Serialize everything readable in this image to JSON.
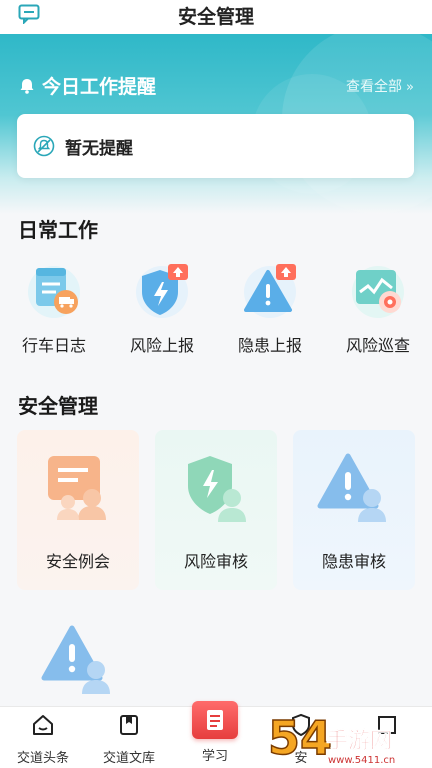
{
  "header": {
    "title": "安全管理"
  },
  "reminder": {
    "title": "今日工作提醒",
    "view_all": "查看全部",
    "view_all_chevron": "»",
    "empty_text": "暂无提醒"
  },
  "daily": {
    "title": "日常工作",
    "items": [
      {
        "label": "行车日志",
        "icon": "logbook-icon"
      },
      {
        "label": "风险上报",
        "icon": "risk-report-icon"
      },
      {
        "label": "隐患上报",
        "icon": "hazard-report-icon"
      },
      {
        "label": "风险巡查",
        "icon": "risk-patrol-icon"
      }
    ]
  },
  "management": {
    "title": "安全管理",
    "items": [
      {
        "label": "安全例会",
        "icon": "meeting-icon"
      },
      {
        "label": "风险审核",
        "icon": "risk-review-icon"
      },
      {
        "label": "隐患审核",
        "icon": "hazard-review-icon"
      }
    ]
  },
  "bottom_nav": {
    "items": [
      {
        "label": "交道头条",
        "icon": "home-icon"
      },
      {
        "label": "交道文库",
        "icon": "library-icon"
      },
      {
        "label": "学习",
        "icon": "study-icon"
      },
      {
        "label": "安",
        "icon": "safety-icon"
      },
      {
        "label": "",
        "icon": "more-icon"
      }
    ]
  },
  "watermark": {
    "text": "54手游网",
    "sub": "www.5411.cn"
  },
  "colors": {
    "accent": "#2fb8c8",
    "study_red": "#e63e3e",
    "warning_red": "#f04a4a"
  }
}
